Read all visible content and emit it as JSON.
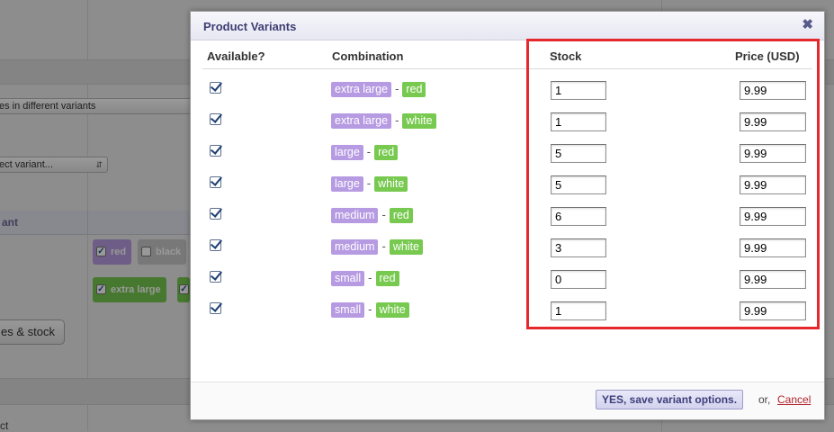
{
  "background": {
    "select_variants_text": "es in different variants",
    "select_variant_text": "ect variant...",
    "table_header_label": "ant",
    "chip_red": "red",
    "chip_black": "black",
    "chip_extra_large": "extra large",
    "prices_stock_button": "es & stock",
    "bottom_text": "ct"
  },
  "modal": {
    "title": "Product Variants",
    "close_glyph": "✖",
    "columns": {
      "available": "Available?",
      "combination": "Combination",
      "stock": "Stock",
      "price": "Price (USD)"
    },
    "separator": "-",
    "rows": [
      {
        "size": "extra large",
        "color": "red",
        "stock": "1",
        "price": "9.99",
        "available": true
      },
      {
        "size": "extra large",
        "color": "white",
        "stock": "1",
        "price": "9.99",
        "available": true
      },
      {
        "size": "large",
        "color": "red",
        "stock": "5",
        "price": "9.99",
        "available": true
      },
      {
        "size": "large",
        "color": "white",
        "stock": "5",
        "price": "9.99",
        "available": true
      },
      {
        "size": "medium",
        "color": "red",
        "stock": "6",
        "price": "9.99",
        "available": true
      },
      {
        "size": "medium",
        "color": "white",
        "stock": "3",
        "price": "9.99",
        "available": true
      },
      {
        "size": "small",
        "color": "red",
        "stock": "0",
        "price": "9.99",
        "available": true
      },
      {
        "size": "small",
        "color": "white",
        "stock": "1",
        "price": "9.99",
        "available": true
      }
    ],
    "footer": {
      "save_label": "YES, save variant options.",
      "or_text": "or,",
      "cancel_label": "Cancel"
    }
  },
  "colors": {
    "size_tag": "#b79be2",
    "color_tag": "#77c94f",
    "highlight": "#e5282b",
    "title": "#3d3d73"
  }
}
